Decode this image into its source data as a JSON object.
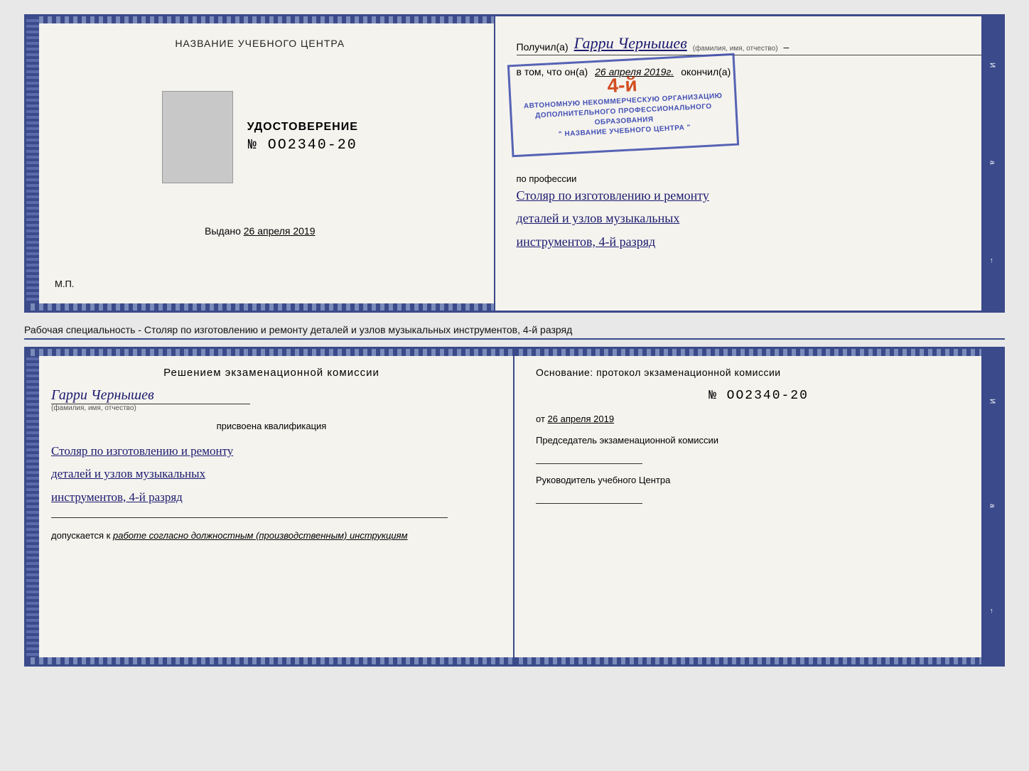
{
  "top_diploma": {
    "left": {
      "section_title": "НАЗВАНИЕ УЧЕБНОГО ЦЕНТРА",
      "udostoverenie": "УДОСТОВЕРЕНИЕ",
      "number": "№ OO2340-20",
      "vydano_label": "Выдано",
      "vydano_date": "26 апреля 2019",
      "mp": "М.П."
    },
    "right": {
      "poluchil": "Получил(а)",
      "name_handwritten": "Гарри Чернышев",
      "fio_label": "(фамилия, имя, отчество)",
      "vtom": "в том, что он(а)",
      "date_italic": "26 апреля 2019г.",
      "okonchil": "окончил(а)",
      "stamp": {
        "number": "4-й",
        "line1": "АВТОНОМНУЮ НЕКОММЕРЧЕСКУЮ ОРГАНИЗАЦИЮ",
        "line2": "ДОПОЛНИТЕЛЬНОГО ПРОФЕССИОНАЛЬНОГО ОБРАЗОВАНИЯ",
        "line3": "\" НАЗВАНИЕ УЧЕБНОГО ЦЕНТРА \""
      },
      "po_professii": "по профессии",
      "profession_line1": "Столяр по изготовлению и ремонту",
      "profession_line2": "деталей и узлов музыкальных",
      "profession_line3": "инструментов, 4-й разряд"
    }
  },
  "middle": {
    "specialty_label": "Рабочая специальность - Столяр по изготовлению и ремонту деталей и узлов музыкальных инструментов, 4-й разряд"
  },
  "bottom_diploma": {
    "left": {
      "komissia_title": "Решением  экзаменационной  комиссии",
      "name_handwritten": "Гарри Чернышев",
      "fio_label": "(фамилия, имя, отчество)",
      "prisvoena": "присвоена квалификация",
      "profession_line1": "Столяр по изготовлению и ремонту",
      "profession_line2": "деталей и узлов музыкальных",
      "profession_line3": "инструментов, 4-й разряд",
      "dopuskaetsya": "допускается к",
      "dopusk_italic": "работе согласно должностным (производственным) инструкциям"
    },
    "right": {
      "osnovanie": "Основание: протокол экзаменационной  комиссии",
      "number": "№  OO2340-20",
      "ot": "от",
      "date": "26 апреля 2019",
      "predsedatel_label": "Председатель экзаменационной комиссии",
      "rukovoditel_label": "Руководитель учебного Центра"
    }
  }
}
